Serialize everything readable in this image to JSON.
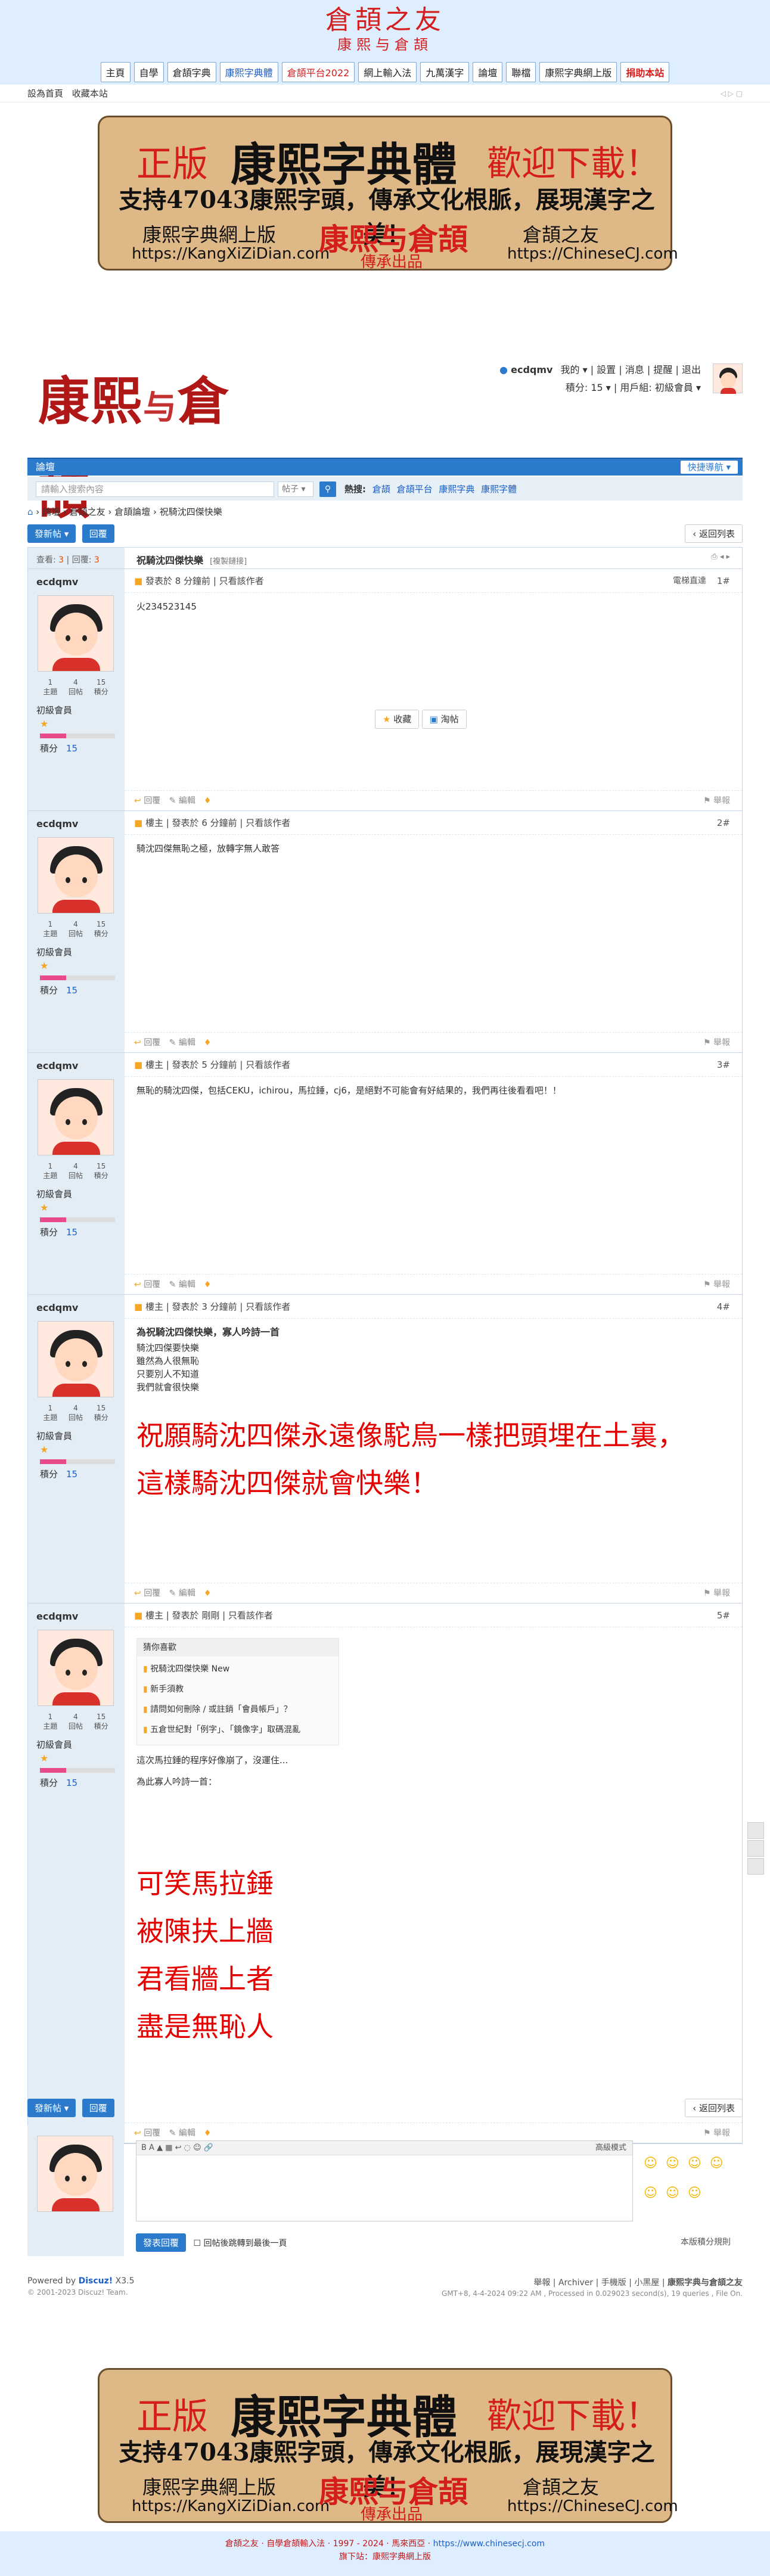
{
  "site": {
    "title": "倉頡之友",
    "subtitle": "康熙与倉頡",
    "nav": [
      {
        "label": "主頁",
        "style": ""
      },
      {
        "label": "自學",
        "style": ""
      },
      {
        "label": "倉頡字典",
        "style": ""
      },
      {
        "label": "康熙字典體",
        "style": "blue"
      },
      {
        "label": "倉頡平台2022",
        "style": "red"
      },
      {
        "label": "網上輸入法",
        "style": ""
      },
      {
        "label": "九萬漢字",
        "style": ""
      },
      {
        "label": "論壇",
        "style": ""
      },
      {
        "label": "聯檔",
        "style": ""
      },
      {
        "label": "康熙字典網上版",
        "style": ""
      },
      {
        "label": "捐助本站",
        "style": "redbold"
      }
    ],
    "toolbar_left": "設為首頁",
    "toolbar_left2": "收藏本站"
  },
  "banner": {
    "zhengban": "正版",
    "kangxi": "康熙字典體",
    "welcome": "歡迎下載！",
    "slogan": "支持47043康熙字頭，傳承文化根脈，展現漢字之美！",
    "left_name": "康熙字典網上版",
    "left_url": "https://KangXiZiDian.com",
    "mid_name": "康熙与倉頡",
    "mid_sub": "傳承出品",
    "right_name": "倉頡之友",
    "right_url": "https://ChineseCJ.com"
  },
  "header": {
    "logo_a": "康熙",
    "logo_b": "与",
    "logo_c": "倉頡",
    "user": "ecdqmv",
    "links": [
      "我的",
      "設置",
      "消息",
      "提醒",
      "退出"
    ],
    "points": "積分: 15",
    "group": "用戶組: 初級會員"
  },
  "nav": {
    "forum": "論壇",
    "quick": "快捷導航"
  },
  "search": {
    "placeholder": "請輸入搜索內容",
    "scope": "帖子",
    "hot_label": "熱搜:",
    "hot": [
      "倉頡",
      "倉頡平台",
      "康熙字典",
      "康熙字體"
    ]
  },
  "breadcrumb": [
    "論壇",
    "倉頡之友",
    "倉頡論壇",
    "祝騎沈四傑快樂"
  ],
  "actions": {
    "new_post": "發新帖",
    "reply": "回覆",
    "back": "返回列表"
  },
  "thread": {
    "views_label": "查看:",
    "views": "3",
    "replies_label": "回覆:",
    "replies": "3",
    "title": "祝騎沈四傑快樂",
    "copy": "[複製鏈接]",
    "jump": "電梯直達"
  },
  "author": {
    "name": "ecdqmv",
    "stats": [
      {
        "v": "1",
        "l": "主題"
      },
      {
        "v": "4",
        "l": "回帖"
      },
      {
        "v": "15",
        "l": "積分"
      }
    ],
    "group": "初級會員",
    "points_label": "積分",
    "points": "15"
  },
  "posts": [
    {
      "head": "發表於 8 分鐘前 | 只看該作者",
      "num": "1#",
      "body": [
        "火234523145"
      ],
      "fav": "收藏",
      "share": "淘帖",
      "reply": "回覆",
      "edit": "編輯",
      "report": "舉報"
    },
    {
      "head": "樓主 | 發表於 6 分鐘前 | 只看該作者",
      "num": "2#",
      "body": [
        "騎沈四傑無恥之極，放轉字無人敢答"
      ],
      "reply": "回覆",
      "edit": "編輯",
      "report": "舉報"
    },
    {
      "head": "樓主 | 發表於 5 分鐘前 | 只看該作者",
      "num": "3#",
      "body": [
        "無恥的騎沈四傑，包括CEKU，ichirou，馬拉錘，cj6，是絕對不可能會有好結果的，我們再往後看看吧！！"
      ],
      "reply": "回覆",
      "edit": "編輯",
      "report": "舉報"
    },
    {
      "head": "樓主 | 發表於 3 分鐘前 | 只看該作者",
      "num": "4#",
      "title": "為祝騎沈四傑快樂，寡人吟詩一首",
      "body": [
        "騎沈四傑要快樂",
        "雖然為人很無恥",
        "只要別人不知道",
        "我們就會很快樂"
      ],
      "big": [
        "祝願騎沈四傑永遠像駝鳥一樣把頭埋在土裏，",
        "這樣騎沈四傑就會快樂！"
      ],
      "reply": "回覆",
      "edit": "編輯",
      "report": "舉報"
    },
    {
      "head": "樓主 | 發表於 剛剛 | 只看該作者",
      "num": "5#",
      "quote_head": "猜你喜歡",
      "quote": [
        "祝騎沈四傑快樂 New",
        "新手須教",
        "請問如何刪除 / 或註銷「會員帳戶」？",
        "五倉世紀對「例字」、「鏡像字」取碼混亂"
      ],
      "body": [
        "這次馬拉錘的程序好像崩了，沒運住...",
        "為此寡人吟詩一首："
      ],
      "big": [
        "可笑馬拉錘",
        "被陳扶上牆",
        "君看牆上者",
        "盡是無恥人"
      ],
      "reply": "回覆",
      "edit": "編輯",
      "report": "舉報"
    }
  ],
  "reply_box": {
    "advanced": "高級模式",
    "submit": "發表回覆",
    "check": "回帖後跳轉到最後一頁",
    "rules": "本版積分規則"
  },
  "footer": {
    "powered": "Powered by",
    "discuz": "Discuz!",
    "version": "X3.5",
    "copyright": "© 2001-2023 Discuz! Team.",
    "links": [
      "舉報",
      "Archiver",
      "手機版",
      "小黑屋",
      "康熙字典与倉頡之友"
    ],
    "meta": "GMT+8, 4-4-2024 09:22 AM , Processed in 0.029023 second(s), 19 queries , File On."
  },
  "bottom": {
    "line1a": "倉頡之友 · 自學倉頡輸入法",
    "line1b": "1997 - 2024",
    "line1c": "馬來西亞",
    "line1d": "https://www.chinesecj.com",
    "line2": "旗下站：康熙字典網上版"
  }
}
